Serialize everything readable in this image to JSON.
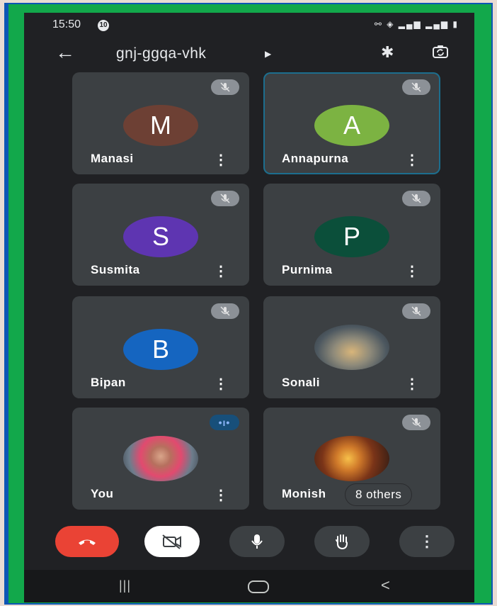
{
  "status_bar": {
    "time": "15:50",
    "notification_badge": "10"
  },
  "meeting": {
    "code": "gnj-ggqa-vhk"
  },
  "icons": {
    "back": "arrow-left-icon",
    "bluetooth": "bluetooth-icon",
    "switch_camera": "switch-camera-icon",
    "mic_off": "mic-off-icon",
    "more": "more-vert-icon"
  },
  "participants": [
    {
      "name": "Manasi",
      "initial": "M",
      "avatar_color": "#6d4034",
      "muted": true
    },
    {
      "name": "Annapurna",
      "initial": "A",
      "avatar_color": "#7cb342",
      "muted": true,
      "highlighted": true
    },
    {
      "name": "Susmita",
      "initial": "S",
      "avatar_color": "#5e35b1",
      "muted": true
    },
    {
      "name": "Purnima",
      "initial": "P",
      "avatar_color": "#0b4f3a",
      "muted": true
    },
    {
      "name": "Bipan",
      "initial": "B",
      "avatar_color": "#1565c0",
      "muted": true
    },
    {
      "name": "Sonali",
      "photo": "landscape-photo",
      "muted": true
    },
    {
      "name": "You",
      "photo": "person-photo",
      "speaking": true
    },
    {
      "name": "Monish",
      "photo": "candles-photo",
      "muted": true,
      "others_label": "8 others"
    }
  ],
  "controls": [
    "end-call",
    "camera-off",
    "microphone",
    "raise-hand",
    "more-options"
  ],
  "colors": {
    "background": "#202124",
    "tile": "#3c4043",
    "end_call": "#ea4335",
    "frame_green": "#12a84b",
    "frame_blue": "#0d56b5"
  }
}
